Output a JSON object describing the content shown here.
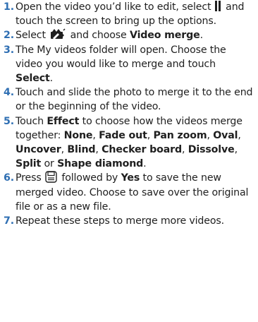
{
  "colors": {
    "step_number": "#2f6fb3",
    "text": "#1f1f1f"
  },
  "steps": [
    {
      "number": "1.",
      "text_a": "Open the video you’d like to edit, select",
      "icon": "pause-icon",
      "text_b": "and touch the screen to bring up the options."
    },
    {
      "number": "2.",
      "text_a": "Select",
      "icon": "edit-video-icon",
      "text_b": "and choose",
      "bold_a": "Video merge",
      "text_c": "."
    },
    {
      "number": "3.",
      "text_a": "The My videos folder will open. Choose the video you would like to merge and touch",
      "bold_a": "Select",
      "text_b": "."
    },
    {
      "number": "4.",
      "text_a": "Touch and slide the photo to merge it to the end or the beginning of the video."
    },
    {
      "number": "5.",
      "text_a": "Touch",
      "bold_effect": "Effect",
      "text_b": "to choose how the videos merge together:",
      "effects": [
        "None",
        "Fade out",
        "Pan zoom",
        "Oval",
        "Uncover",
        "Blind",
        "Checker board",
        "Dissolve",
        "Split",
        "Shape diamond"
      ],
      "sep": ",",
      "or_word": "or",
      "end": "."
    },
    {
      "number": "6.",
      "text_a": "Press",
      "icon": "save-icon",
      "text_b": "followed by",
      "bold_a": "Yes",
      "text_c": "to save the new merged video. Choose to save over the original file or as a new file."
    },
    {
      "number": "7.",
      "text_a": "Repeat these steps to merge more videos."
    }
  ]
}
